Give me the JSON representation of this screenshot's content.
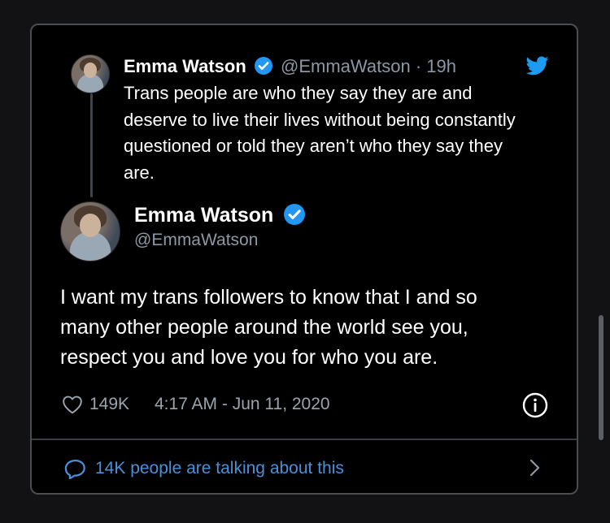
{
  "quoted_tweet": {
    "name": "Emma Watson",
    "handle": "@EmmaWatson",
    "time": "· 19h",
    "text_lines": [
      "Trans people are who they say they are and",
      "deserve to live their lives without being constantly",
      "questioned or told they aren’t who they say they",
      "are."
    ]
  },
  "main_tweet": {
    "name": "Emma Watson",
    "handle": "@EmmaWatson",
    "text_lines": [
      "I want my trans followers to know that I and so",
      "many other people around the world see you,",
      "respect you and love you for who you are."
    ],
    "likes": "149K",
    "timestamp": "4:17 AM - Jun 11, 2020"
  },
  "footer": {
    "label": "14K people are talking about this"
  },
  "icons": {
    "brand": "twitter-bird-icon",
    "verified": "verified-badge-icon",
    "like": "heart-icon",
    "info": "info-icon",
    "reply": "comment-icon",
    "more": "chevron-right-icon"
  },
  "colors": {
    "background": "#000000",
    "accent": "#1d9bf0",
    "link": "#4a90d9",
    "text": "#ffffff",
    "secondary": "#8b98a5"
  }
}
